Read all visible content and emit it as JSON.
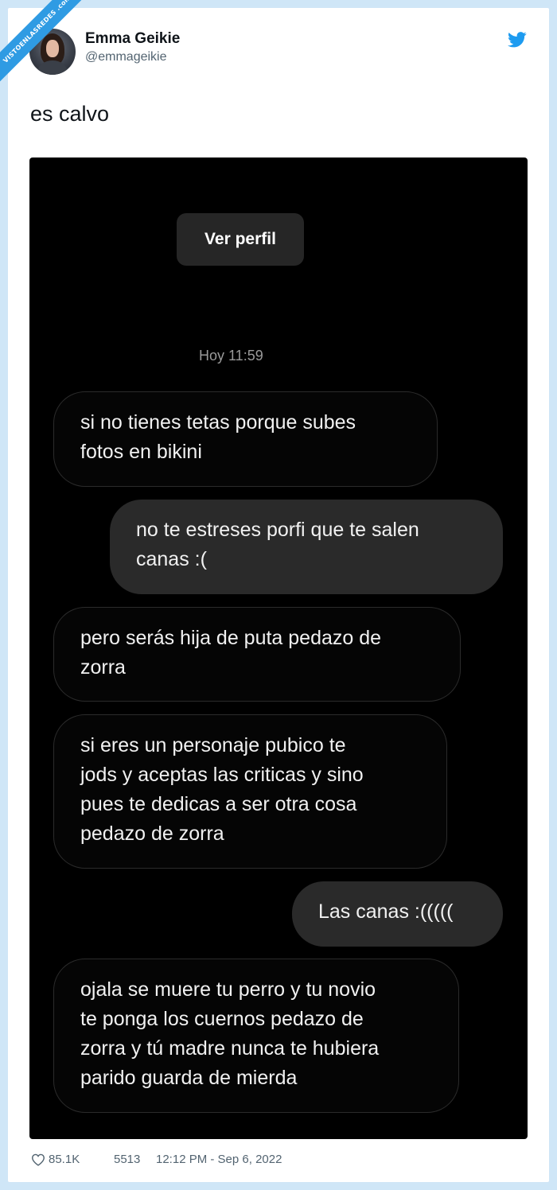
{
  "watermark": "VISTOENLASREDES .com",
  "author": {
    "name": "Emma Geikie",
    "handle": "@emmageikie"
  },
  "tweet_text": "es calvo",
  "chat": {
    "profile_button": "Ver perfil",
    "timestamp": "Hoy 11:59",
    "messages": [
      {
        "side": "in",
        "lines": [
          "si no tienes tetas porque subes",
          "fotos en bikini"
        ]
      },
      {
        "side": "out",
        "lines": [
          "no te estreses porfi que te salen",
          "canas :("
        ]
      },
      {
        "side": "in",
        "lines": [
          "pero serás hija de puta pedazo de",
          "zorra"
        ]
      },
      {
        "side": "in",
        "lines": [
          "si eres un personaje pubico te",
          "jods y aceptas las criticas y sino",
          "pues te dedicas a ser otra cosa",
          "pedazo de zorra"
        ]
      },
      {
        "side": "out",
        "lines": [
          "Las canas :((((("
        ]
      },
      {
        "side": "in",
        "lines": [
          "ojala se muere tu perro y tu novio",
          "te ponga los cuernos pedazo de",
          "zorra y tú madre nunca te hubiera",
          "parido guarda de mierda"
        ]
      }
    ]
  },
  "footer": {
    "likes": "85.1K",
    "replies": "5513",
    "datetime": "12:12 PM - Sep 6, 2022"
  },
  "colors": {
    "twitter_blue": "#1d9bf0",
    "page_bg": "#cfe6f7",
    "chat_bg": "#000000"
  },
  "icons": {
    "brand": "twitter-bird-icon",
    "like": "heart-icon"
  }
}
